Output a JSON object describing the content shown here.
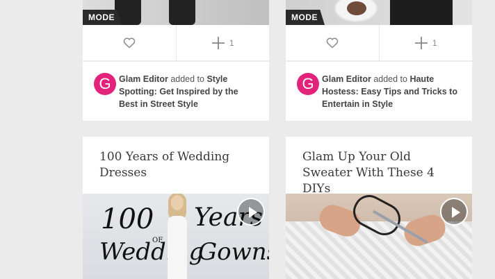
{
  "cards_top": [
    {
      "badge": "MODE",
      "count": "1",
      "user": "Glam Editor",
      "verb": " added to ",
      "board": "Style Spotting: Get Inspired by the Best in Street Style",
      "avatar_letter": "G"
    },
    {
      "badge": "MODE",
      "count": "1",
      "user": "Glam Editor",
      "verb": " added to ",
      "board": "Haute Hostess: Easy Tips and Tricks to Entertain in Style",
      "avatar_letter": "G"
    }
  ],
  "cards_bottom": [
    {
      "title": "100 Years of Wedding Dresses",
      "script_1": "100",
      "script_2": "Years",
      "script_3": "Wedding",
      "script_4": "Gowns",
      "script_of": "OF"
    },
    {
      "title": "Glam Up Your Old Sweater With These 4 DIYs"
    }
  ],
  "icons": {
    "like": "heart-icon",
    "add": "plus-icon",
    "play": "play-icon",
    "avatar": "avatar-icon"
  },
  "colors": {
    "background": "#ebebeb",
    "card": "#ffffff",
    "avatar": "#e3227b",
    "badge": "#2a2a2a"
  }
}
